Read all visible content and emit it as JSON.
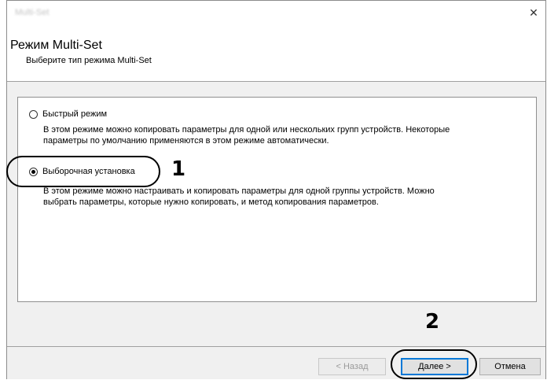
{
  "window": {
    "title": "Multi-Set",
    "close_glyph": "✕"
  },
  "header": {
    "title": "Режим Multi-Set",
    "subtitle": "Выберите тип режима Multi-Set"
  },
  "options": [
    {
      "label": "Быстрый режим",
      "selected": false,
      "description_lines": [
        "В этом режиме можно копировать параметры для одной или нескольких групп устройств. Некоторые",
        "параметры по умолчанию применяются в этом режиме автоматически."
      ]
    },
    {
      "label": "Выборочная установка",
      "selected": true,
      "description_lines": [
        "В этом режиме можно настраивать и копировать параметры для одной группы устройств. Можно",
        "выбрать параметры, которые нужно копировать, и метод копирования параметров."
      ]
    }
  ],
  "callouts": {
    "one": "1",
    "two": "2"
  },
  "buttons": {
    "back": "< Назад",
    "next": "Далее >",
    "cancel": "Отмена"
  },
  "icons": {
    "close": "close-icon"
  }
}
